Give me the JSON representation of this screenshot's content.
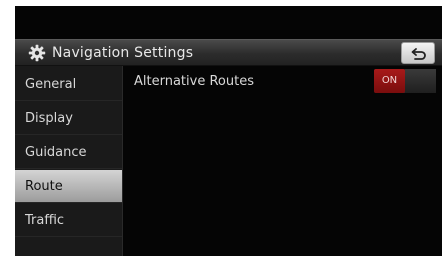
{
  "header": {
    "title": "Navigation Settings",
    "icon": "gear-icon",
    "back_icon": "back-arrow-icon"
  },
  "sidebar": {
    "items": [
      {
        "label": "General",
        "active": false
      },
      {
        "label": "Display",
        "active": false
      },
      {
        "label": "Guidance",
        "active": false
      },
      {
        "label": "Route",
        "active": true
      },
      {
        "label": "Traffic",
        "active": false
      }
    ]
  },
  "main": {
    "setting_label": "Alternative Routes",
    "toggle_state": "ON",
    "toggle_color": "#a81a1a"
  }
}
